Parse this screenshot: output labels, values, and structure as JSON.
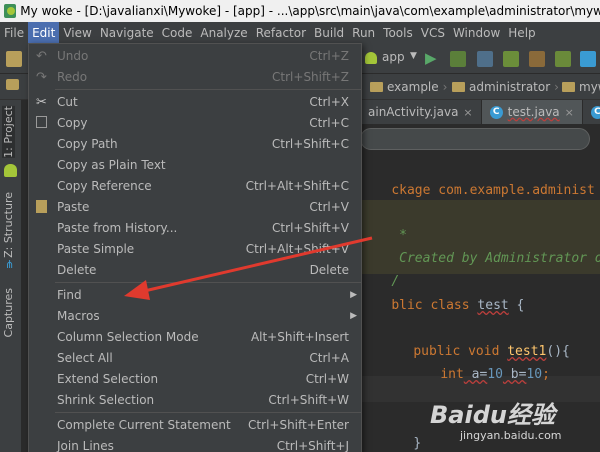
{
  "window": {
    "title": "My woke - [D:\\javalianxi\\Mywoke] - [app] - ...\\app\\src\\main\\java\\com\\example\\administrator\\mywoke\\test.java"
  },
  "menubar": {
    "items": [
      {
        "label": "File"
      },
      {
        "label": "Edit"
      },
      {
        "label": "View"
      },
      {
        "label": "Navigate"
      },
      {
        "label": "Code"
      },
      {
        "label": "Analyze"
      },
      {
        "label": "Refactor"
      },
      {
        "label": "Build"
      },
      {
        "label": "Run"
      },
      {
        "label": "Tools"
      },
      {
        "label": "VCS"
      },
      {
        "label": "Window"
      },
      {
        "label": "Help"
      }
    ]
  },
  "toolbar": {
    "run_config": "app"
  },
  "navbar": {
    "crumbs": [
      "example",
      "administrator",
      "myw"
    ]
  },
  "left_tabs": {
    "project": "1: Project",
    "structure": "Z: Structure",
    "captures": "Captures"
  },
  "editor_tabs": [
    {
      "label": "ainActivity.java",
      "close": "×"
    },
    {
      "label": "test.java",
      "close": "×"
    },
    {
      "label": "A",
      "close": ""
    }
  ],
  "editor": {
    "line_package": "ckage com.example.administ",
    "line_comment_star": " *",
    "line_comment_created": " Created by Administrator o",
    "line_comment_end": "/",
    "line_class_kw": "blic class",
    "line_class_name": "test",
    "line_class_brace": " {",
    "line_method_kw": "public void",
    "line_method_name": "test1",
    "line_method_rest": "(){",
    "line_int_kw": "int",
    "line_int_a": " a=",
    "line_int_10a": "10",
    "line_int_b": " b=",
    "line_int_10b": "10",
    "line_int_end": ";",
    "line_close": "}"
  },
  "edit_menu": {
    "items": [
      {
        "label": "Undo",
        "shortcut": "Ctrl+Z",
        "disabled": true,
        "icon": "undo-icon"
      },
      {
        "label": "Redo",
        "shortcut": "Ctrl+Shift+Z",
        "disabled": true,
        "icon": "redo-icon"
      },
      {
        "label": "Cut",
        "shortcut": "Ctrl+X",
        "icon": "cut-icon"
      },
      {
        "label": "Copy",
        "shortcut": "Ctrl+C",
        "icon": "copy-icon"
      },
      {
        "label": "Copy Path",
        "shortcut": "Ctrl+Shift+C"
      },
      {
        "label": "Copy as Plain Text",
        "shortcut": ""
      },
      {
        "label": "Copy Reference",
        "shortcut": "Ctrl+Alt+Shift+C"
      },
      {
        "label": "Paste",
        "shortcut": "Ctrl+V",
        "icon": "paste-icon"
      },
      {
        "label": "Paste from History...",
        "shortcut": "Ctrl+Shift+V"
      },
      {
        "label": "Paste Simple",
        "shortcut": "Ctrl+Alt+Shift+V"
      },
      {
        "label": "Delete",
        "shortcut": "Delete"
      },
      {
        "label": "Find",
        "shortcut": "",
        "submenu": true
      },
      {
        "label": "Macros",
        "shortcut": "",
        "submenu": true
      },
      {
        "label": "Column Selection Mode",
        "shortcut": "Alt+Shift+Insert"
      },
      {
        "label": "Select All",
        "shortcut": "Ctrl+A"
      },
      {
        "label": "Extend Selection",
        "shortcut": "Ctrl+W"
      },
      {
        "label": "Shrink Selection",
        "shortcut": "Ctrl+Shift+W"
      },
      {
        "label": "Complete Current Statement",
        "shortcut": "Ctrl+Shift+Enter"
      },
      {
        "label": "Join Lines",
        "shortcut": "Ctrl+Shift+J"
      }
    ]
  },
  "watermark": {
    "logo": "Baidu经验",
    "url": "jingyan.baidu.com"
  },
  "colors": {
    "menu_active": "#4b6eaf",
    "annotation_arrow": "#e03a2e",
    "keyword": "#cc7832",
    "comment": "#629755"
  }
}
